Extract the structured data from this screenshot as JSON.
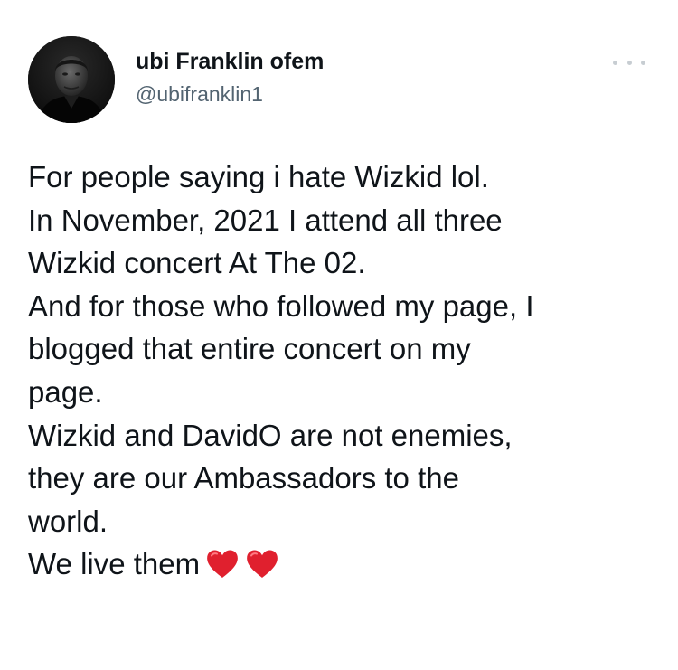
{
  "user": {
    "display_name": "ubi Franklin ofem",
    "handle": "@ubifranklin1"
  },
  "more_icon": "ellipsis-horizontal-icon",
  "tweet": {
    "lines": [
      "For people saying i hate Wizkid lol.",
      "In November, 2021 I attend all three",
      "Wizkid concert At The 02.",
      "And for those who followed my page, I",
      "blogged that entire concert on my",
      "page.",
      "Wizkid and DavidO are not enemies,",
      "they are our Ambassadors to the",
      "world.",
      "We live them"
    ],
    "emoji": [
      "red-heart",
      "red-heart"
    ]
  },
  "colors": {
    "name_text": "#0f1419",
    "handle_text": "#536471",
    "heart": "#e0202e",
    "more_dots": "#c7cdd2"
  }
}
